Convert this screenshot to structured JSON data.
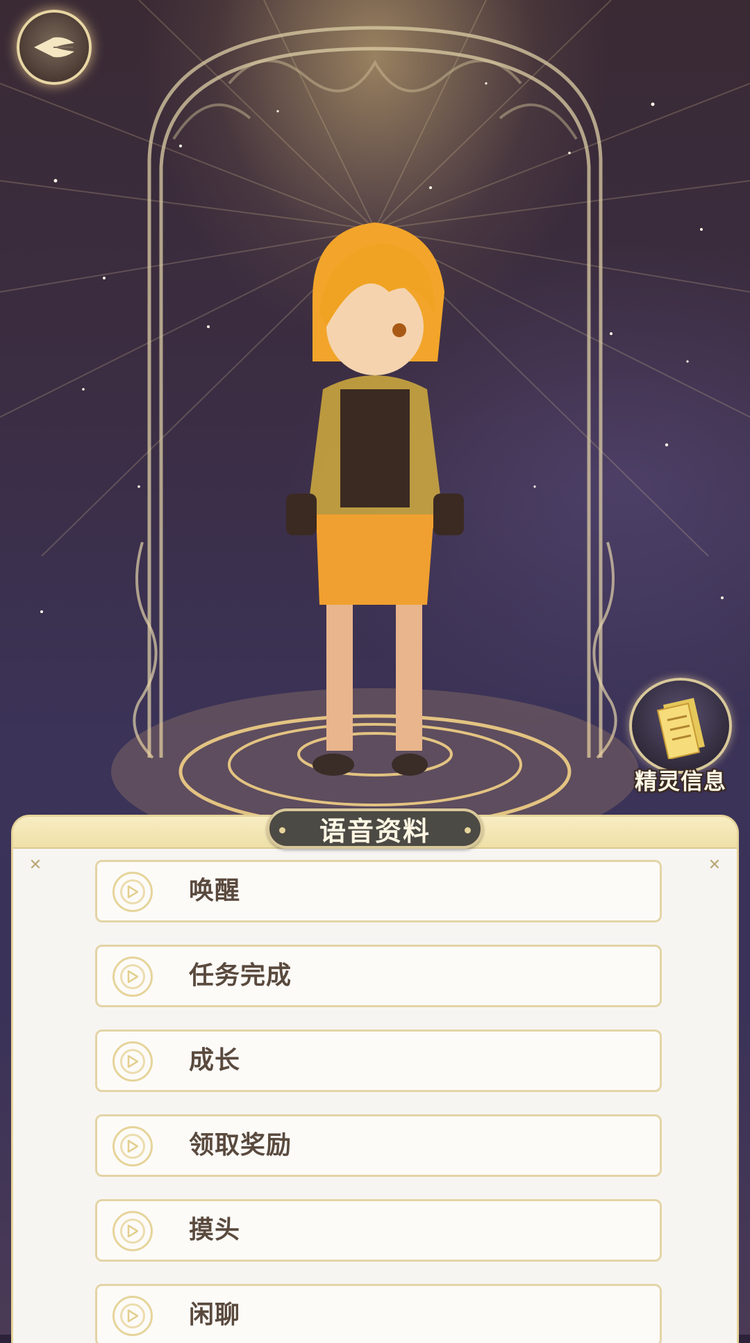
{
  "header": {
    "back_icon": "leaf-arrow-back-icon"
  },
  "side_actions": {
    "spirit_info_label": "精灵信息",
    "spirit_info_icon": "scroll-document-icon"
  },
  "voice_panel": {
    "title": "语音资料",
    "items": [
      {
        "label": "唤醒"
      },
      {
        "label": "任务完成"
      },
      {
        "label": "成长"
      },
      {
        "label": "领取奖励"
      },
      {
        "label": "摸头"
      },
      {
        "label": "闲聊"
      }
    ]
  },
  "colors": {
    "accent_gold": "#e6d49a",
    "panel_bg": "#f7f5f2",
    "title_pill": "#4c4a44",
    "text_brown": "#5a4a3e"
  }
}
